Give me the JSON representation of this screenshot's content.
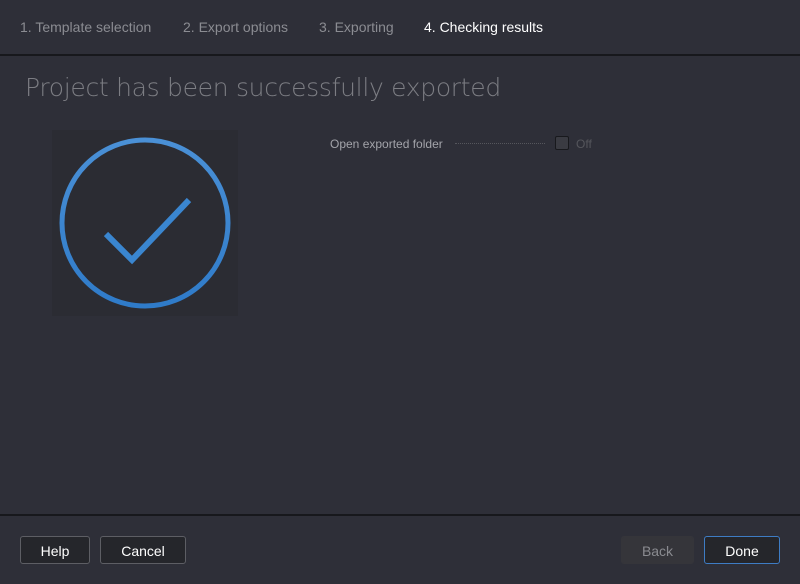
{
  "wizard": {
    "steps": [
      {
        "label": "1. Template selection",
        "active": false
      },
      {
        "label": "2. Export options",
        "active": false
      },
      {
        "label": "3. Exporting",
        "active": false
      },
      {
        "label": "4. Checking results",
        "active": true
      }
    ]
  },
  "main": {
    "title": "Project has been successfully exported",
    "status_icon": "check-circle-icon",
    "accent_color": "#3d85d1",
    "options": {
      "open_folder_label": "Open exported folder",
      "open_folder_checked": false,
      "open_folder_state": "Off"
    }
  },
  "footer": {
    "help": "Help",
    "cancel": "Cancel",
    "back": "Back",
    "done": "Done"
  }
}
